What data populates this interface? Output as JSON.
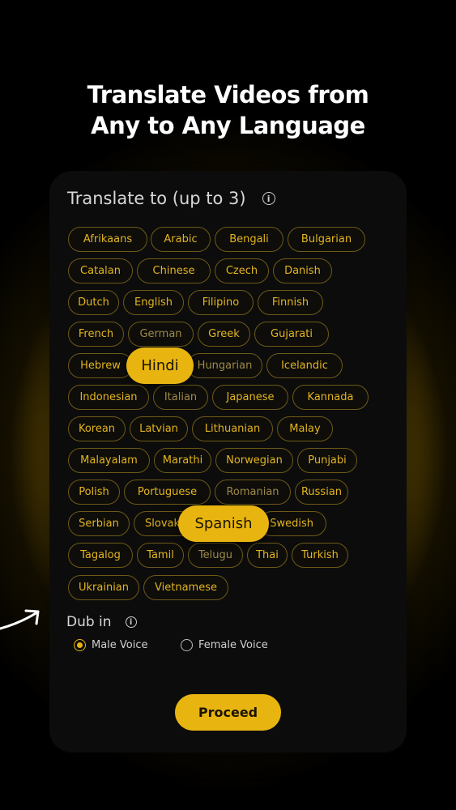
{
  "headline": {
    "line1": "Translate Videos from",
    "line2": "Any to Any Language"
  },
  "translate_section": {
    "title": "Translate to (up to 3)",
    "info_icon": "info-icon"
  },
  "languages": [
    {
      "label": "Afrikaans",
      "selected": false
    },
    {
      "label": "Arabic",
      "selected": false
    },
    {
      "label": "Bengali",
      "selected": false
    },
    {
      "label": "Bulgarian",
      "selected": false
    },
    {
      "label": "Catalan",
      "selected": false
    },
    {
      "label": "Chinese",
      "selected": false
    },
    {
      "label": "Czech",
      "selected": false
    },
    {
      "label": "Danish",
      "selected": false
    },
    {
      "label": "Dutch",
      "selected": false
    },
    {
      "label": "English",
      "selected": false
    },
    {
      "label": "Filipino",
      "selected": false
    },
    {
      "label": "Finnish",
      "selected": false
    },
    {
      "label": "French",
      "selected": false
    },
    {
      "label": "German",
      "selected": false
    },
    {
      "label": "Greek",
      "selected": false
    },
    {
      "label": "Gujarati",
      "selected": false
    },
    {
      "label": "Hebrew",
      "selected": false
    },
    {
      "label": "Hindi",
      "selected": true
    },
    {
      "label": "Hungarian",
      "selected": false
    },
    {
      "label": "Icelandic",
      "selected": false
    },
    {
      "label": "Indonesian",
      "selected": false
    },
    {
      "label": "Italian",
      "selected": false
    },
    {
      "label": "Japanese",
      "selected": false
    },
    {
      "label": "Kannada",
      "selected": false
    },
    {
      "label": "Korean",
      "selected": false
    },
    {
      "label": "Latvian",
      "selected": false
    },
    {
      "label": "Lithuanian",
      "selected": false
    },
    {
      "label": "Malay",
      "selected": false
    },
    {
      "label": "Malayalam",
      "selected": false
    },
    {
      "label": "Marathi",
      "selected": false
    },
    {
      "label": "Norwegian",
      "selected": false
    },
    {
      "label": "Punjabi",
      "selected": false
    },
    {
      "label": "Polish",
      "selected": false
    },
    {
      "label": "Portuguese",
      "selected": false
    },
    {
      "label": "Romanian",
      "selected": false
    },
    {
      "label": "Russian",
      "selected": false
    },
    {
      "label": "Serbian",
      "selected": false
    },
    {
      "label": "Slovak",
      "selected": false
    },
    {
      "label": "Spanish",
      "selected": true
    },
    {
      "label": "Swedish",
      "selected": false
    },
    {
      "label": "Tagalog",
      "selected": false
    },
    {
      "label": "Tamil",
      "selected": false
    },
    {
      "label": "Telugu",
      "selected": false
    },
    {
      "label": "Thai",
      "selected": false
    },
    {
      "label": "Turkish",
      "selected": false
    },
    {
      "label": "Ukrainian",
      "selected": false
    },
    {
      "label": "Vietnamese",
      "selected": false
    }
  ],
  "dub_section": {
    "title": "Dub in",
    "info_icon": "info-icon",
    "options": [
      {
        "label": "Male Voice",
        "selected": true
      },
      {
        "label": "Female Voice",
        "selected": false
      }
    ]
  },
  "proceed_button": {
    "label": "Proceed"
  },
  "colors": {
    "accent": "#e8b40f",
    "chip_text": "#e3b51f",
    "panel": "#0c0c0c",
    "background": "#000000"
  }
}
